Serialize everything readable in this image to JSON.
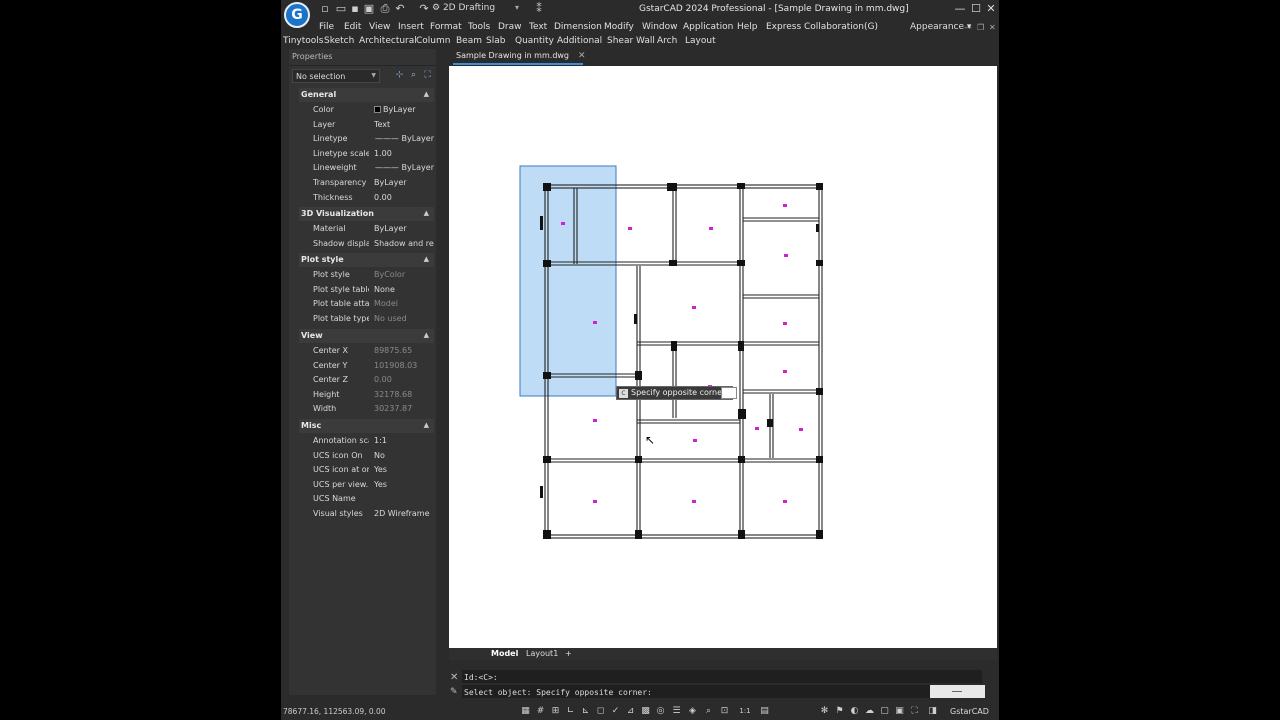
{
  "app": {
    "title": "GstarCAD 2024 Professional - [Sample Drawing in mm.dwg]",
    "logo_letter": "G",
    "workspace": "2D Drafting",
    "appearance": "Appearance"
  },
  "menu": [
    "File",
    "Edit",
    "View",
    "Insert",
    "Format",
    "Tools",
    "Draw",
    "Text",
    "Dimension",
    "Modify",
    "Window",
    "Application",
    "Help",
    "Express",
    "Collaboration(G)"
  ],
  "toolbar2": [
    "Tinytools",
    "Sketch",
    "Architectural",
    "Column",
    "Beam",
    "Slab",
    "Quantity",
    "Additional",
    "Shear Wall",
    "Arch",
    "Layout"
  ],
  "properties": {
    "title": "Properties",
    "selection": "No selection",
    "sections": {
      "general": {
        "title": "General",
        "rows": [
          {
            "name": "Color",
            "value": "ByLayer"
          },
          {
            "name": "Layer",
            "value": "Text"
          },
          {
            "name": "Linetype",
            "value": "——— ByLayer"
          },
          {
            "name": "Linetype scale",
            "value": "1.00"
          },
          {
            "name": "Lineweight",
            "value": "——— ByLayer"
          },
          {
            "name": "Transparency",
            "value": "ByLayer"
          },
          {
            "name": "Thickness",
            "value": "0.00"
          }
        ]
      },
      "viz3d": {
        "title": "3D Visualization",
        "rows": [
          {
            "name": "Material",
            "value": "ByLayer"
          },
          {
            "name": "Shadow display",
            "value": "Shadow and re..."
          }
        ]
      },
      "plotstyle": {
        "title": "Plot style",
        "rows": [
          {
            "name": "Plot style",
            "value": "ByColor"
          },
          {
            "name": "Plot style table",
            "value": "None"
          },
          {
            "name": "Plot table atta...",
            "value": "Model"
          },
          {
            "name": "Plot table type",
            "value": "No used"
          }
        ]
      },
      "view": {
        "title": "View",
        "rows": [
          {
            "name": "Center X",
            "value": "89875.65"
          },
          {
            "name": "Center Y",
            "value": "101908.03"
          },
          {
            "name": "Center Z",
            "value": "0.00"
          },
          {
            "name": "Height",
            "value": "32178.68"
          },
          {
            "name": "Width",
            "value": "30237.87"
          }
        ]
      },
      "misc": {
        "title": "Misc",
        "rows": [
          {
            "name": "Annotation scale",
            "value": "1:1"
          },
          {
            "name": "UCS icon On",
            "value": "No"
          },
          {
            "name": "UCS icon at or...",
            "value": "Yes"
          },
          {
            "name": "UCS per view...",
            "value": "Yes"
          },
          {
            "name": "UCS Name",
            "value": ""
          },
          {
            "name": "Visual styles",
            "value": "2D Wireframe"
          }
        ]
      }
    }
  },
  "document_tab": "Sample Drawing in mm.dwg",
  "tooltip": "Specify opposite corner:",
  "layout_tabs": [
    "Model",
    "Layout1",
    "+"
  ],
  "command": {
    "history": "Id:<C>:",
    "prompt": "Select object: Specify opposite corner:"
  },
  "status": {
    "coords": "78677.16, 112563.09, 0.00",
    "brand": "GstarCAD",
    "scale": "1:1"
  },
  "colors": {
    "selection_fill": "#bfdcf7",
    "selection_border": "#3c78c0",
    "marker": "#d020d0",
    "accent": "#3b8ed8"
  }
}
